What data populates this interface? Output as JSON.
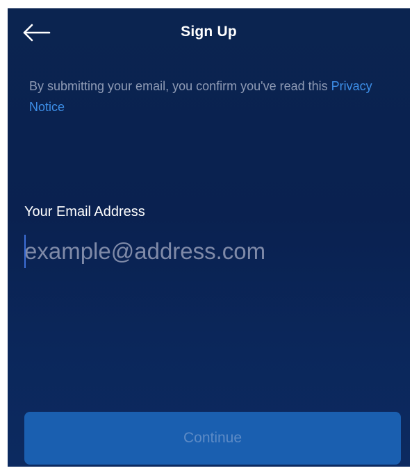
{
  "header": {
    "title": "Sign Up",
    "back_icon": "arrow-left-icon"
  },
  "notice": {
    "text": "By submitting your email, you confirm you've read this ",
    "link_label": "Privacy Notice"
  },
  "email": {
    "label": "Your Email Address",
    "placeholder": "example@address.com",
    "value": ""
  },
  "actions": {
    "continue_label": "Continue",
    "continue_enabled": false
  },
  "colors": {
    "background": "#0b2450",
    "link": "#3d8fe8",
    "button": "#1a5fb0",
    "button_text_disabled": "#5d8bc6",
    "secondary_text": "#8f9bb5"
  }
}
